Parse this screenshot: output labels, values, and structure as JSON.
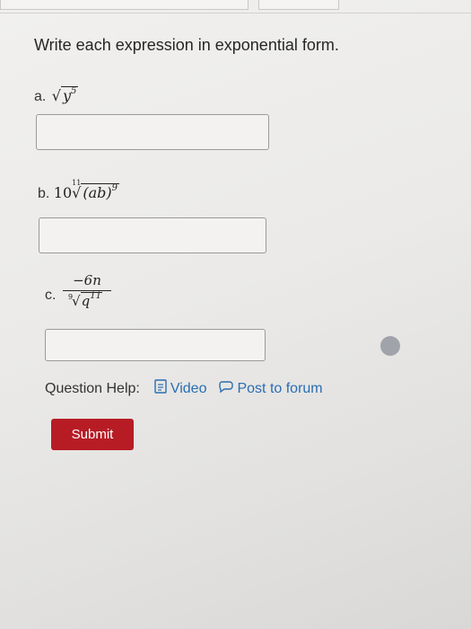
{
  "prompt": "Write each expression in exponential form.",
  "questions": [
    {
      "label": "a.",
      "expression": {
        "radicand": "y",
        "radicand_exp": "5"
      }
    },
    {
      "label": "b.",
      "expression": {
        "coef": "10",
        "index": "11",
        "radicand": "(ab)",
        "radicand_exp": "9"
      }
    },
    {
      "label": "c.",
      "expression": {
        "numerator": "−6n",
        "index": "9",
        "radicand": "q",
        "radicand_exp": "11"
      }
    }
  ],
  "help": {
    "label": "Question Help:",
    "video": "Video",
    "forum": "Post to forum"
  },
  "submit_label": "Submit",
  "colors": {
    "submit": "#b71c25",
    "link": "#2a6db3"
  },
  "icons": [
    "document-icon",
    "chat-bubble-icon"
  ]
}
